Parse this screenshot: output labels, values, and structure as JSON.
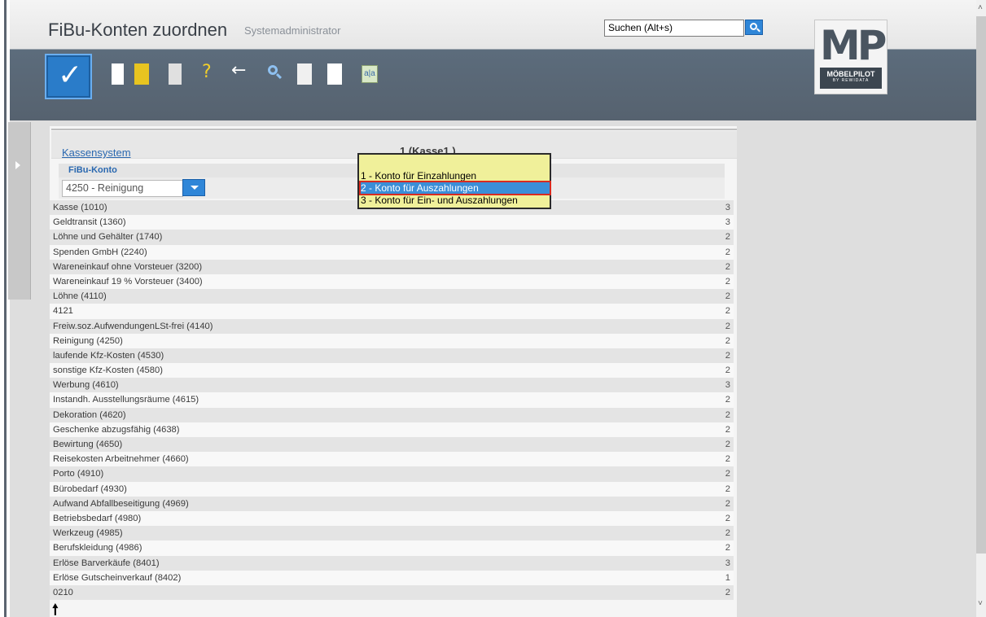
{
  "header": {
    "title": "FiBu-Konten zuordnen",
    "subtitle": "Systemadministrator",
    "search_placeholder": "Suchen (Alt+s)"
  },
  "logo": {
    "mark": "MP",
    "brand": "MÖBELPILOT",
    "brand_sub": "BY REWIDATA"
  },
  "toolbar": {
    "ok_icon": "✓",
    "help_icon": "?",
    "back_icon": "←",
    "aa_label": "a|a"
  },
  "section": {
    "link": "Kassensystem",
    "title": "1 (Kasse1 )"
  },
  "fibu": {
    "label": "FiBu-Konto",
    "selected": "4250 - Reinigung"
  },
  "dropdown": {
    "options": [
      "1 - Konto für Einzahlungen",
      "2 - Konto für Auszahlungen",
      "3 - Konto für Ein- und Auszahlungen"
    ],
    "selected_index": 1
  },
  "accounts": [
    {
      "name": "Kasse (1010)",
      "code": "3"
    },
    {
      "name": "Geldtransit (1360)",
      "code": "3"
    },
    {
      "name": "Löhne und Gehälter (1740)",
      "code": "2"
    },
    {
      "name": "Spenden GmbH (2240)",
      "code": "2"
    },
    {
      "name": "Wareneinkauf ohne Vorsteuer (3200)",
      "code": "2"
    },
    {
      "name": "Wareneinkauf 19 % Vorsteuer (3400)",
      "code": "2"
    },
    {
      "name": "Löhne (4110)",
      "code": "2"
    },
    {
      "name": "4121",
      "code": "2"
    },
    {
      "name": "Freiw.soz.AufwendungenLSt-frei (4140)",
      "code": "2"
    },
    {
      "name": "Reinigung (4250)",
      "code": "2"
    },
    {
      "name": "laufende Kfz-Kosten (4530)",
      "code": "2"
    },
    {
      "name": "sonstige Kfz-Kosten (4580)",
      "code": "2"
    },
    {
      "name": "Werbung (4610)",
      "code": "3"
    },
    {
      "name": "Instandh. Ausstellungsräume (4615)",
      "code": "2"
    },
    {
      "name": "Dekoration (4620)",
      "code": "2"
    },
    {
      "name": "Geschenke abzugsfähig (4638)",
      "code": "2"
    },
    {
      "name": "Bewirtung (4650)",
      "code": "2"
    },
    {
      "name": "Reisekosten Arbeitnehmer (4660)",
      "code": "2"
    },
    {
      "name": "Porto (4910)",
      "code": "2"
    },
    {
      "name": "Bürobedarf (4930)",
      "code": "2"
    },
    {
      "name": "Aufwand Abfallbeseitigung (4969)",
      "code": "2"
    },
    {
      "name": "Betriebsbedarf (4980)",
      "code": "2"
    },
    {
      "name": "Werkzeug (4985)",
      "code": "2"
    },
    {
      "name": "Berufskleidung (4986)",
      "code": "2"
    },
    {
      "name": "Erlöse Barverkäufe (8401)",
      "code": "3"
    },
    {
      "name": "Erlöse Gutscheinverkauf (8402)",
      "code": "1"
    },
    {
      "name": "0210",
      "code": "2"
    }
  ],
  "footer": {
    "up_arrow": "🠕"
  },
  "scroll": {
    "up": "˄",
    "down": "˅"
  }
}
